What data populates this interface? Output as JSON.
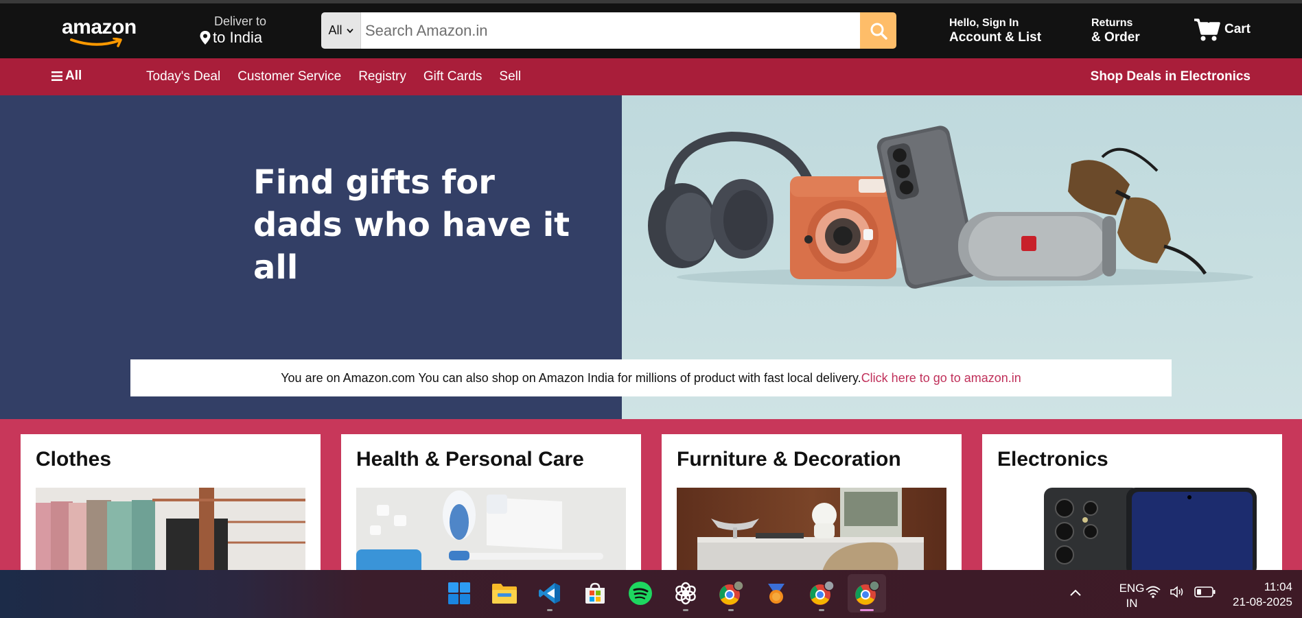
{
  "header": {
    "logo_text": "amazon",
    "deliver_to": "Deliver to",
    "deliver_location": "to India",
    "search_category": "All",
    "search_placeholder": "Search Amazon.in",
    "account_line1": "Hello, Sign In",
    "account_line2": "Account & List",
    "returns_line1": "Returns",
    "returns_line2": "& Order",
    "cart_label": "Cart"
  },
  "nav": {
    "all_label": "All",
    "links": [
      "Today's Deal",
      "Customer Service",
      "Registry",
      "Gift Cards",
      "Sell"
    ],
    "deals_label": "Shop Deals in Electronics"
  },
  "hero": {
    "title_line1": "Find gifts for",
    "title_line2": "dads who have it all"
  },
  "notice": {
    "text": "You are on Amazon.com You can also shop on Amazon India for millions of product with fast local delivery.",
    "link_text": "Click here to go to amazon.in"
  },
  "cards": [
    {
      "title": "Clothes"
    },
    {
      "title": "Health & Personal Care"
    },
    {
      "title": "Furniture & Decoration"
    },
    {
      "title": "Electronics"
    }
  ],
  "taskbar": {
    "apps": [
      "windows-start",
      "file-explorer",
      "vs-code",
      "microsoft-store",
      "spotify",
      "chatgpt",
      "chrome",
      "orbit-app",
      "chrome",
      "chrome"
    ],
    "language_line1": "ENG",
    "language_line2": "IN",
    "time": "11:04",
    "date": "21-08-2025"
  },
  "colors": {
    "header_bg": "#121212",
    "nav_bg": "#a91e3a",
    "hero_left_bg": "#333f66",
    "page_bg": "#c8375a",
    "search_button": "#febd69",
    "link_color": "#c0305a"
  }
}
